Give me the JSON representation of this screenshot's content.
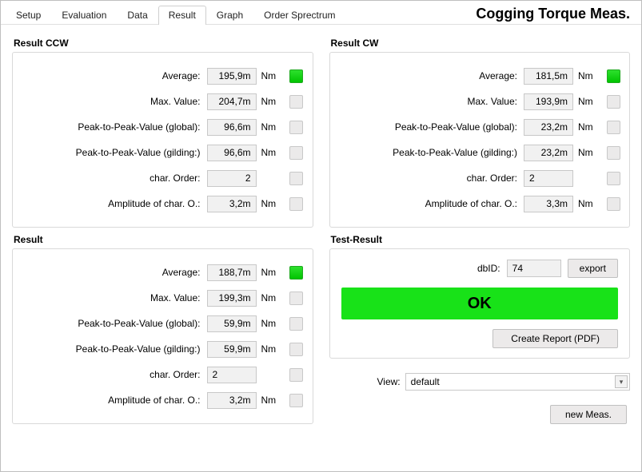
{
  "title": "Cogging Torque Meas.",
  "tabs": [
    "Setup",
    "Evaluation",
    "Data",
    "Result",
    "Graph",
    "Order Sprectrum"
  ],
  "activeTab": "Result",
  "unit": "Nm",
  "labels": {
    "average": "Average:",
    "max": "Max. Value:",
    "p2p_global": "Peak-to-Peak-Value (global):",
    "p2p_gilding": "Peak-to-Peak-Value (gilding:)",
    "char_order": "char. Order:",
    "amp_char": "Amplitude of char. O.:"
  },
  "panels": {
    "ccw": {
      "title": "Result CCW",
      "average": "195,9m",
      "max": "204,7m",
      "p2p_global": "96,6m",
      "p2p_gilding": "96,6m",
      "char_order": "2",
      "amp_char": "3,2m",
      "avg_green": true
    },
    "cw": {
      "title": "Result CW",
      "average": "181,5m",
      "max": "193,9m",
      "p2p_global": "23,2m",
      "p2p_gilding": "23,2m",
      "char_order": "2",
      "amp_char": "3,3m",
      "avg_green": true
    },
    "res": {
      "title": "Result",
      "average": "188,7m",
      "max": "199,3m",
      "p2p_global": "59,9m",
      "p2p_gilding": "59,9m",
      "char_order": "2",
      "amp_char": "3,2m",
      "avg_green": true
    }
  },
  "test": {
    "title": "Test-Result",
    "dbid_label": "dbID:",
    "dbid": "74",
    "export": "export",
    "ok": "OK",
    "create_report": "Create Report (PDF)"
  },
  "view": {
    "label": "View:",
    "value": "default"
  },
  "new_meas": "new Meas."
}
